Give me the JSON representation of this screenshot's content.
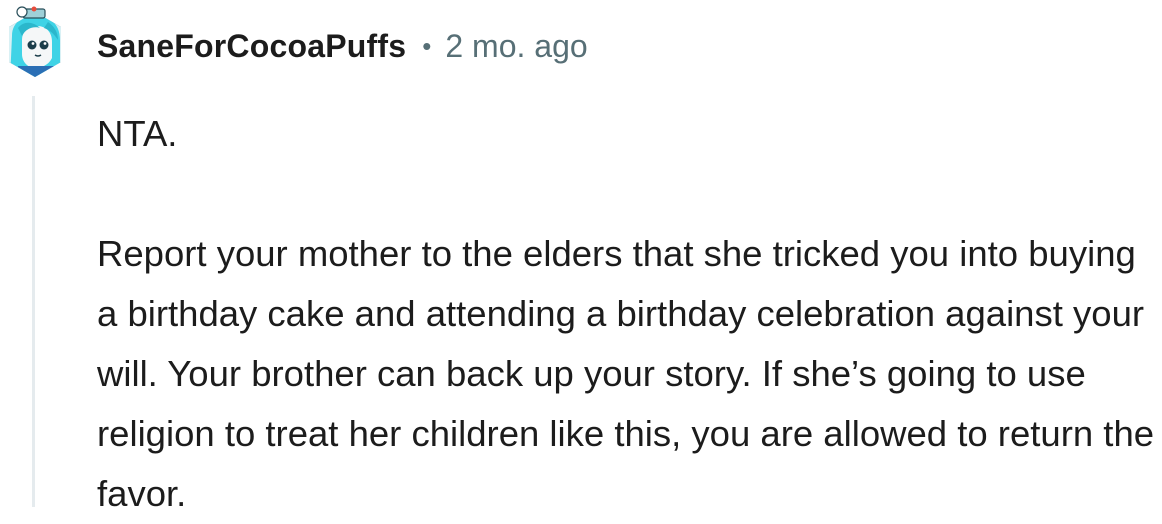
{
  "comment": {
    "author": "SaneForCocoaPuffs",
    "separator": "•",
    "timestamp": "2 mo. ago",
    "verdict": "NTA.",
    "body": "Report your mother to the elders that she tricked you into buying a birthday cake and attending a birthday celebration against your will. Your brother can back up your story. If she’s going to use religion to treat her children like this, you are allowed to return the favor."
  },
  "avatar": {
    "icon": "user-avatar-icon",
    "hair_color": "#3fd3e6",
    "border_color": "#1d5f74"
  },
  "colors": {
    "text": "#1c1c1c",
    "meta": "#576f76",
    "thread_line": "#e5ebee"
  }
}
